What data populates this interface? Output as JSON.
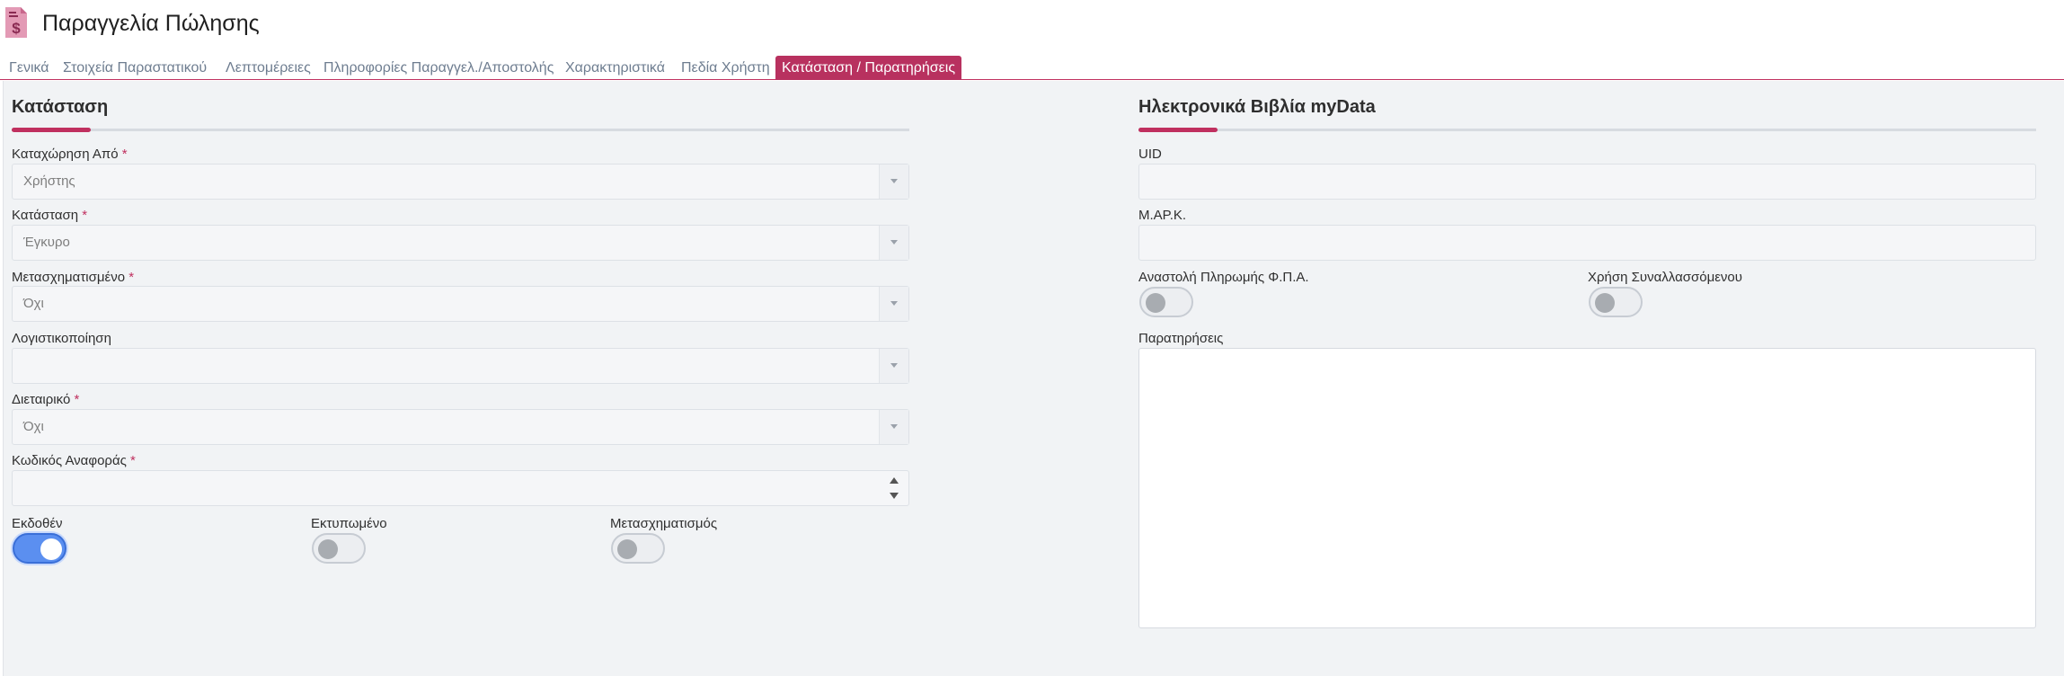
{
  "header": {
    "title": "Παραγγελία Πώλησης",
    "icon": "sales-document-icon",
    "accent_color": "#c0305f"
  },
  "tabs": [
    {
      "label": "Γενικά"
    },
    {
      "label": "Στοιχεία Παραστατικού"
    },
    {
      "label": "Λεπτομέρειες"
    },
    {
      "label": "Πληροφορίες Παραγγελ./Αποστολής"
    },
    {
      "label": "Χαρακτηριστικά"
    },
    {
      "label": "Πεδία Χρήστη"
    },
    {
      "label": "Κατάσταση / Παρατηρήσεις",
      "active": true
    }
  ],
  "status_section": {
    "title": "Κατάσταση",
    "fields": {
      "registered_by": {
        "label": "Καταχώρηση Από",
        "required": "*",
        "value": "Χρήστης"
      },
      "status": {
        "label": "Κατάσταση",
        "required": "*",
        "value": "Έγκυρο"
      },
      "transformed": {
        "label": "Μετασχηματισμένο",
        "required": "*",
        "value": "Όχι"
      },
      "accounting": {
        "label": "Λογιστικοποίηση",
        "value": ""
      },
      "intercompany": {
        "label": "Διεταιρικό",
        "required": "*",
        "value": "Όχι"
      },
      "reference_code": {
        "label": "Κωδικός Αναφοράς",
        "required": "*",
        "value": ""
      }
    },
    "toggles": {
      "issued": {
        "label": "Εκδοθέν",
        "on": true
      },
      "printed": {
        "label": "Εκτυπωμένο",
        "on": false
      },
      "transformation": {
        "label": "Μετασχηματισμός",
        "on": false
      }
    }
  },
  "mydata_section": {
    "title": "Ηλεκτρονικά Βιβλία myData",
    "fields": {
      "uid": {
        "label": "UID",
        "value": ""
      },
      "mark": {
        "label": "Μ.ΑΡ.Κ.",
        "value": ""
      }
    },
    "toggles": {
      "vat_suspension": {
        "label": "Αναστολή Πληρωμής Φ.Π.Α.",
        "on": false
      },
      "counterparty_use": {
        "label": "Χρήση Συναλλασσόμενου",
        "on": false
      }
    },
    "notes": {
      "label": "Παρατηρήσεις",
      "value": ""
    }
  }
}
